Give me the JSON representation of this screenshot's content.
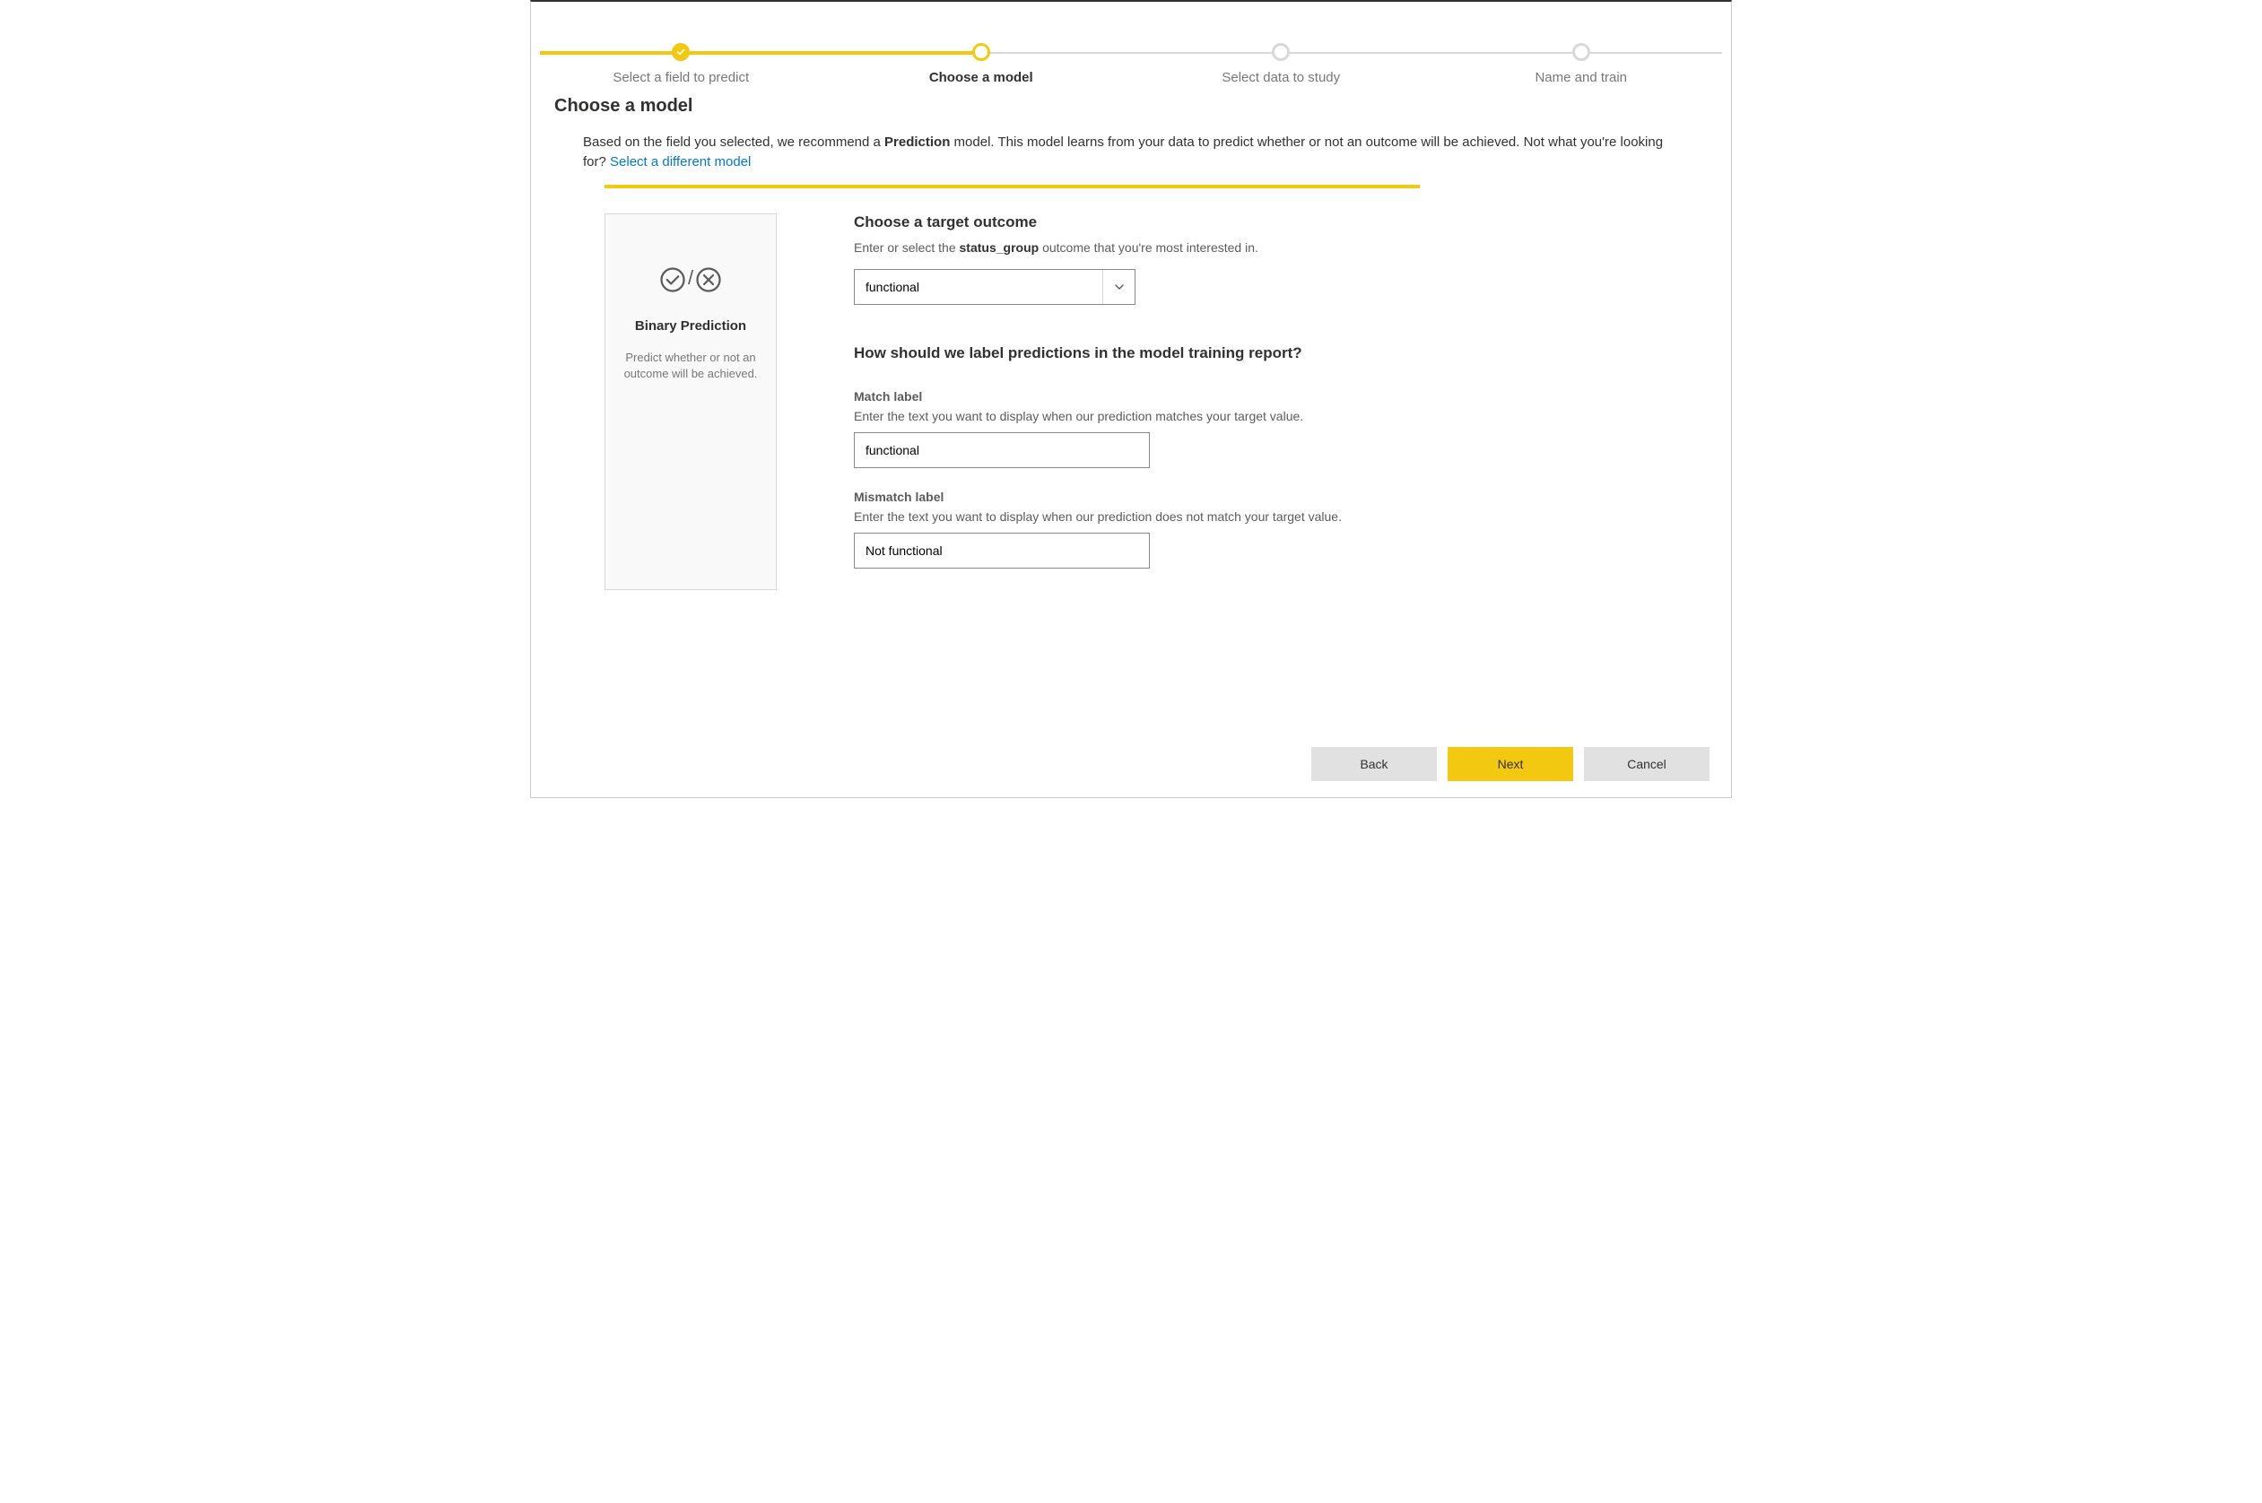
{
  "stepper": {
    "steps": [
      {
        "label": "Select a field to predict"
      },
      {
        "label": "Choose a model"
      },
      {
        "label": "Select data to study"
      },
      {
        "label": "Name and train"
      }
    ]
  },
  "page": {
    "title": "Choose a model",
    "intro_prefix": "Based on the field you selected, we recommend a ",
    "intro_model_word": "Prediction",
    "intro_suffix": " model. This model learns from your data to predict whether or not an outcome will be achieved. Not what you're looking for? ",
    "intro_link": "Select a different model"
  },
  "model_card": {
    "name": "Binary Prediction",
    "desc": "Predict whether or not an outcome will be achieved."
  },
  "target": {
    "heading": "Choose a target outcome",
    "sub_prefix": "Enter or select the ",
    "sub_field": "status_group",
    "sub_suffix": " outcome that you're most interested in.",
    "value": "functional"
  },
  "labels": {
    "heading": "How should we label predictions in the model training report?",
    "match_label": "Match label",
    "match_sub": "Enter the text you want to display when our prediction matches your target value.",
    "match_value": "functional",
    "mismatch_label": "Mismatch label",
    "mismatch_sub": "Enter the text you want to display when our prediction does not match your target value.",
    "mismatch_value": "Not functional"
  },
  "footer": {
    "back": "Back",
    "next": "Next",
    "cancel": "Cancel"
  }
}
